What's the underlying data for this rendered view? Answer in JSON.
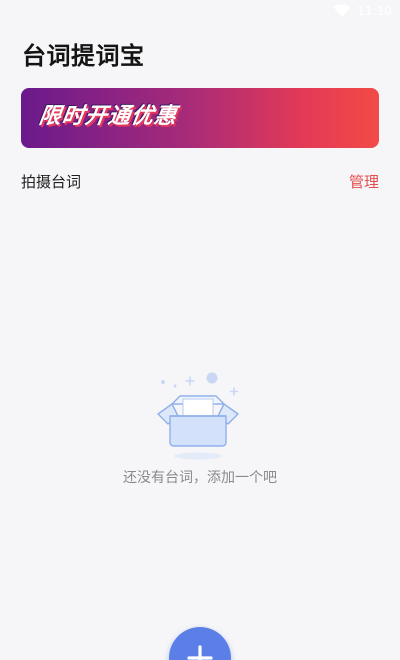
{
  "status_bar": {
    "time": "11:10",
    "wifi_icon": "wifi-icon"
  },
  "app": {
    "title": "台词提词宝"
  },
  "promo": {
    "label": "限时开通优惠",
    "gradient_start": "#6a1a8c",
    "gradient_end": "#f24a46"
  },
  "section": {
    "label": "拍摄台词",
    "manage_label": "管理",
    "manage_color": "#e54e4e"
  },
  "empty_state": {
    "illustration_icon": "empty-box-icon",
    "message": "还没有台词，添加一个吧"
  },
  "fab": {
    "icon": "plus-icon",
    "color": "#5b7fe6"
  }
}
